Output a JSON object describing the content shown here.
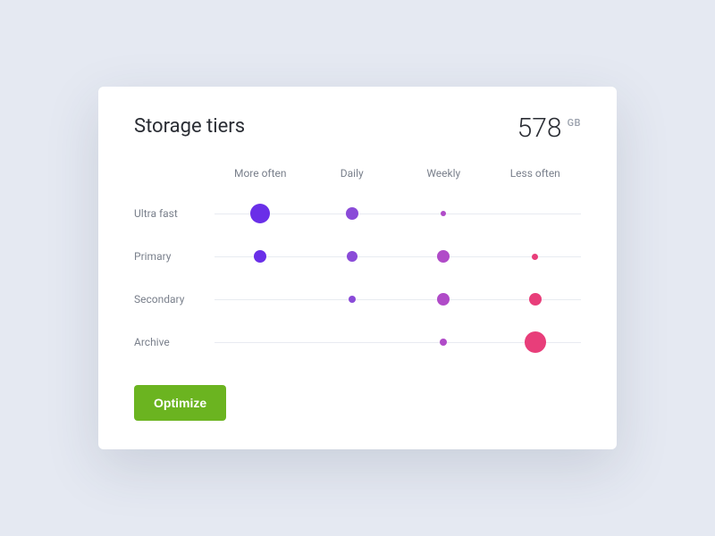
{
  "card": {
    "title": "Storage tiers",
    "total_value": "578",
    "total_unit": "GB",
    "optimize_label": "Optimize"
  },
  "columns": [
    "More often",
    "Daily",
    "Weekly",
    "Less often"
  ],
  "rows": [
    "Ultra fast",
    "Primary",
    "Secondary",
    "Archive"
  ],
  "colors": {
    "col0": "#6a2fe8",
    "col1": "#8a4bd8",
    "col2": "#b04bc8",
    "col3": "#e83e7a",
    "button": "#6bb420"
  },
  "chart_data": {
    "type": "scatter",
    "title": "Storage tiers",
    "xlabel": "",
    "ylabel": "",
    "x_categories": [
      "More often",
      "Daily",
      "Weekly",
      "Less often"
    ],
    "y_categories": [
      "Ultra fast",
      "Primary",
      "Secondary",
      "Archive"
    ],
    "size_unit": "relative",
    "points": [
      {
        "row": "Ultra fast",
        "col": "More often",
        "size": 22
      },
      {
        "row": "Ultra fast",
        "col": "Daily",
        "size": 14
      },
      {
        "row": "Ultra fast",
        "col": "Weekly",
        "size": 6
      },
      {
        "row": "Ultra fast",
        "col": "Less often",
        "size": 0
      },
      {
        "row": "Primary",
        "col": "More often",
        "size": 14
      },
      {
        "row": "Primary",
        "col": "Daily",
        "size": 12
      },
      {
        "row": "Primary",
        "col": "Weekly",
        "size": 14
      },
      {
        "row": "Primary",
        "col": "Less often",
        "size": 7
      },
      {
        "row": "Secondary",
        "col": "More often",
        "size": 0
      },
      {
        "row": "Secondary",
        "col": "Daily",
        "size": 8
      },
      {
        "row": "Secondary",
        "col": "Weekly",
        "size": 14
      },
      {
        "row": "Secondary",
        "col": "Less often",
        "size": 14
      },
      {
        "row": "Archive",
        "col": "More often",
        "size": 0
      },
      {
        "row": "Archive",
        "col": "Daily",
        "size": 0
      },
      {
        "row": "Archive",
        "col": "Weekly",
        "size": 8
      },
      {
        "row": "Archive",
        "col": "Less often",
        "size": 24
      }
    ]
  }
}
